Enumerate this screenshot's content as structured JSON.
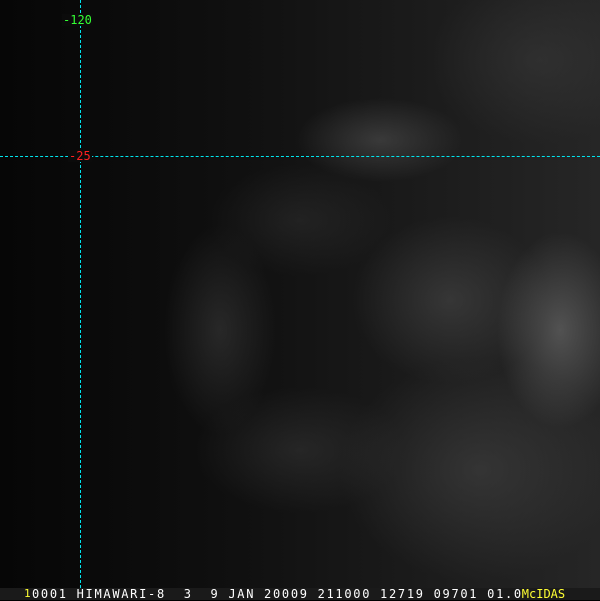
{
  "overlay": {
    "longitude_label": "-120",
    "latitude_label": "-25",
    "grid_color": "#00e5ee",
    "longitude_label_color": "#33ff33",
    "latitude_label_color": "#ff2020"
  },
  "status_bar": {
    "frame_number": "1",
    "text": "0001 HIMAWARI-8  3  9 JAN 20009 211000 12719 09701 01.00",
    "brand": "McIDAS",
    "brand_color": "#ffff33"
  }
}
